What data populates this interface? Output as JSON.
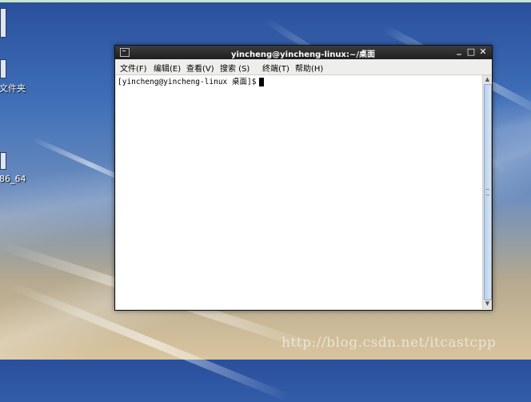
{
  "desktop": {
    "icons": [
      {
        "label": "文件夹",
        "icon": "folder-icon"
      },
      {
        "label": "86_64",
        "icon": "disc-icon"
      }
    ],
    "watermark": "http://blog.csdn.net/itcastcpp"
  },
  "window": {
    "title": "yincheng@yincheng-linux:~/桌面",
    "controls": {
      "minimize": "_",
      "maximize": "□",
      "close": "✕"
    },
    "menu": [
      {
        "label": "文件(F)"
      },
      {
        "label": "编辑(E)"
      },
      {
        "label": "查看(V)"
      },
      {
        "label": "搜索 (S)"
      },
      {
        "label": "终端(T)"
      },
      {
        "label": "帮助(H)"
      }
    ],
    "terminal": {
      "prompt": "[yincheng@yincheng-linux 桌面]$"
    }
  },
  "colors": {
    "titlebar": "#2b2b2b",
    "terminal_bg": "#ffffff",
    "scroll_thumb": "#c8dbf0"
  }
}
